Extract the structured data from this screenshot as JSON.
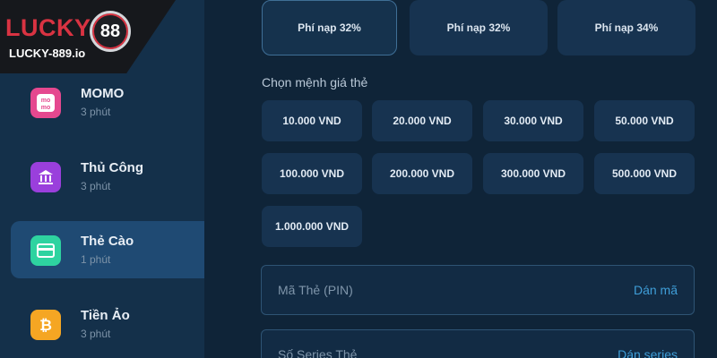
{
  "brand": {
    "name": "LUCKY",
    "badge": "88",
    "domain": "LUCKY-889.io"
  },
  "sidebar": {
    "items": [
      {
        "label": "MOMO",
        "time": "3 phút",
        "icon": "momo-icon",
        "color": "#e5488f"
      },
      {
        "label": "Thủ Công",
        "time": "3 phút",
        "icon": "bank-icon",
        "color": "#9a3fdc"
      },
      {
        "label": "Thẻ Cào",
        "time": "1 phút",
        "icon": "card-icon",
        "color": "#2ed3a0",
        "active": true
      },
      {
        "label": "Tiền Ảo",
        "time": "3 phút",
        "icon": "bitcoin-icon",
        "color": "#f5a623"
      }
    ]
  },
  "fees": [
    {
      "label": "Phí nạp 32%",
      "selected": true
    },
    {
      "label": "Phí nạp 32%"
    },
    {
      "label": "Phí nạp 34%"
    }
  ],
  "amounts": {
    "label": "Chọn mệnh giá thẻ",
    "options": [
      "10.000 VND",
      "20.000 VND",
      "30.000 VND",
      "50.000 VND",
      "100.000 VND",
      "200.000 VND",
      "300.000 VND",
      "500.000 VND",
      "1.000.000 VND"
    ]
  },
  "form": {
    "pin": {
      "label": "Mã Thẻ (PIN)",
      "action": "Dán mã"
    },
    "serial": {
      "label": "Số Series Thẻ",
      "action": "Dán series"
    }
  },
  "colors": {
    "background": "#0f2438",
    "sidebar": "#14304a",
    "active": "#1f4a73",
    "link": "#3f9ed8",
    "brand_red": "#d93342"
  }
}
